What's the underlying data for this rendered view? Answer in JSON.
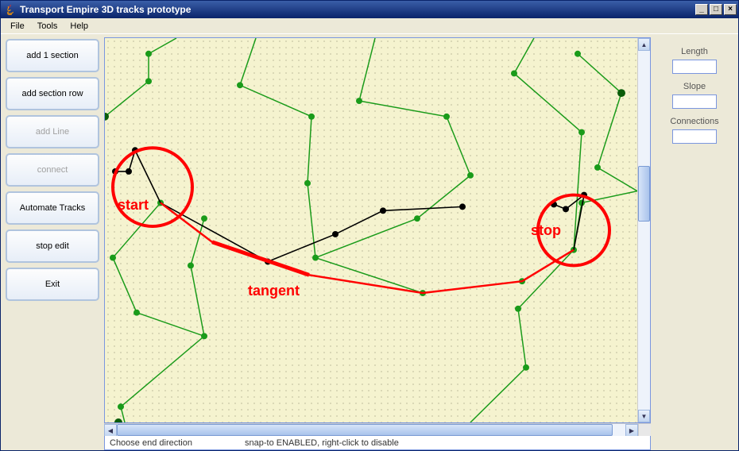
{
  "window": {
    "title": "Transport Empire 3D tracks prototype"
  },
  "menu": {
    "file": "File",
    "tools": "Tools",
    "help": "Help"
  },
  "toolButtons": {
    "add1": "add 1 section",
    "addRow": "add section row",
    "addLine": "add Line",
    "connect": "connect",
    "automate": "Automate Tracks",
    "stopEdit": "stop edit",
    "exit": "Exit"
  },
  "properties": {
    "lengthLabel": "Length",
    "lengthValue": "",
    "slopeLabel": "Slope",
    "slopeValue": "",
    "connectionsLabel": "Connections",
    "connectionsValue": ""
  },
  "status": {
    "hint": "Choose end direction",
    "snap": "snap-to ENABLED, right-click to disable"
  },
  "annotations": {
    "start": "start",
    "stop": "stop",
    "tangent": "tangent"
  }
}
